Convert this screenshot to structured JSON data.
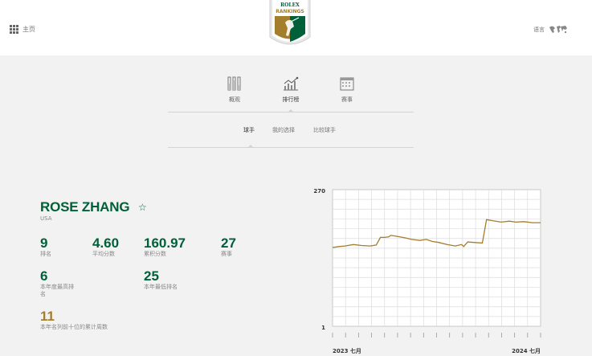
{
  "header": {
    "home_label": "主页",
    "lang_label": "语言",
    "logo": {
      "top_text": "ROLEX",
      "bottom_text": "RANKINGS"
    }
  },
  "tabs": [
    {
      "label": "概观",
      "icon": "bars-icon"
    },
    {
      "label": "排行榜",
      "icon": "line-chart-icon",
      "active": true
    },
    {
      "label": "赛事",
      "icon": "calendar-icon"
    }
  ],
  "subtabs": [
    {
      "label": "球手",
      "active": true
    },
    {
      "label": "我的选择"
    },
    {
      "label": "比较球手"
    }
  ],
  "player": {
    "name": "ROSE ZHANG",
    "country": "USA",
    "stats": [
      {
        "value": "9",
        "label": "排名"
      },
      {
        "value": "4.60",
        "label": "平均分数"
      },
      {
        "value": "160.97",
        "label": "累积分数"
      },
      {
        "value": "27",
        "label": "赛事"
      },
      {
        "value": "6",
        "label": "本年度最高排名"
      },
      {
        "value": "25",
        "label": "本年最低排名"
      },
      {
        "value": "11",
        "label": "本年名列前十位的累计周数"
      }
    ]
  },
  "colors": {
    "accent_green": "#006039",
    "gold": "#a37e2c"
  },
  "chart_data": {
    "type": "line",
    "y_axis_top_label": "270",
    "y_axis_bottom_label": "1",
    "x_start_label": "2023 七月",
    "x_end_label": "2024 七月",
    "y_reversed": true,
    "ylim": [
      1,
      270
    ],
    "grid": true,
    "series": [
      {
        "points": [
          [
            0.0,
            115
          ],
          [
            0.03,
            113
          ],
          [
            0.06,
            112
          ],
          [
            0.1,
            109
          ],
          [
            0.14,
            111
          ],
          [
            0.18,
            112
          ],
          [
            0.21,
            110
          ],
          [
            0.23,
            95
          ],
          [
            0.25,
            95
          ],
          [
            0.27,
            94
          ],
          [
            0.28,
            91
          ],
          [
            0.31,
            93
          ],
          [
            0.35,
            96
          ],
          [
            0.38,
            99
          ],
          [
            0.42,
            101
          ],
          [
            0.45,
            99
          ],
          [
            0.48,
            103
          ],
          [
            0.51,
            105
          ],
          [
            0.55,
            109
          ],
          [
            0.59,
            112
          ],
          [
            0.62,
            109
          ],
          [
            0.63,
            113
          ],
          [
            0.65,
            104
          ],
          [
            0.68,
            105
          ],
          [
            0.72,
            106
          ],
          [
            0.74,
            60
          ],
          [
            0.77,
            62
          ],
          [
            0.81,
            65
          ],
          [
            0.85,
            63
          ],
          [
            0.88,
            65
          ],
          [
            0.92,
            64
          ],
          [
            0.96,
            66
          ],
          [
            1.0,
            66
          ]
        ]
      }
    ]
  }
}
